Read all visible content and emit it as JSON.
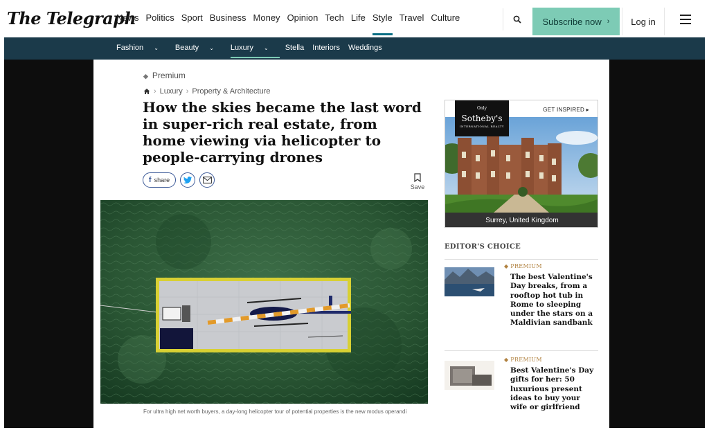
{
  "header": {
    "logo": "The Telegraph",
    "nav": [
      "News",
      "Politics",
      "Sport",
      "Business",
      "Money",
      "Opinion",
      "Tech",
      "Life",
      "Style",
      "Travel",
      "Culture"
    ],
    "active_nav": "Style",
    "subscribe_label": "Subscribe now",
    "login_label": "Log in"
  },
  "subnav": {
    "items": [
      "Fashion",
      "Beauty",
      "Luxury",
      "Stella",
      "Interiors",
      "Weddings"
    ],
    "active": "Luxury"
  },
  "article": {
    "premium_label": "Premium",
    "breadcrumb": [
      "Luxury",
      "Property & Architecture"
    ],
    "headline": "How the skies became the last word in super-rich real estate, from home viewing via helicopter to people-carrying drones",
    "share_label": "share",
    "save_label": "Save",
    "caption": "For ultra high net worth buyers, a day-long helicopter tour of potential properties is the new modus operandi"
  },
  "ad": {
    "only": "Only",
    "brand": "Sotheby's",
    "brand_sub": "INTERNATIONAL REALTY",
    "cta": "GET INSPIRED",
    "location": "Surrey, United Kingdom"
  },
  "editors_choice": {
    "heading": "EDITOR'S CHOICE",
    "items": [
      {
        "badge": "PREMIUM",
        "title": "The best Valentine's Day breaks, from a rooftop hot tub in Rome to sleeping under the stars on a Maldivian sandbank"
      },
      {
        "badge": "PREMIUM",
        "title": "Best Valentine's Day gifts for her: 50 luxurious present ideas to buy your wife or girlfriend"
      }
    ]
  },
  "colors": {
    "accent": "#7dcbb5",
    "subnav_bg": "#1b3a4a",
    "premium_gold": "#b0813f"
  }
}
